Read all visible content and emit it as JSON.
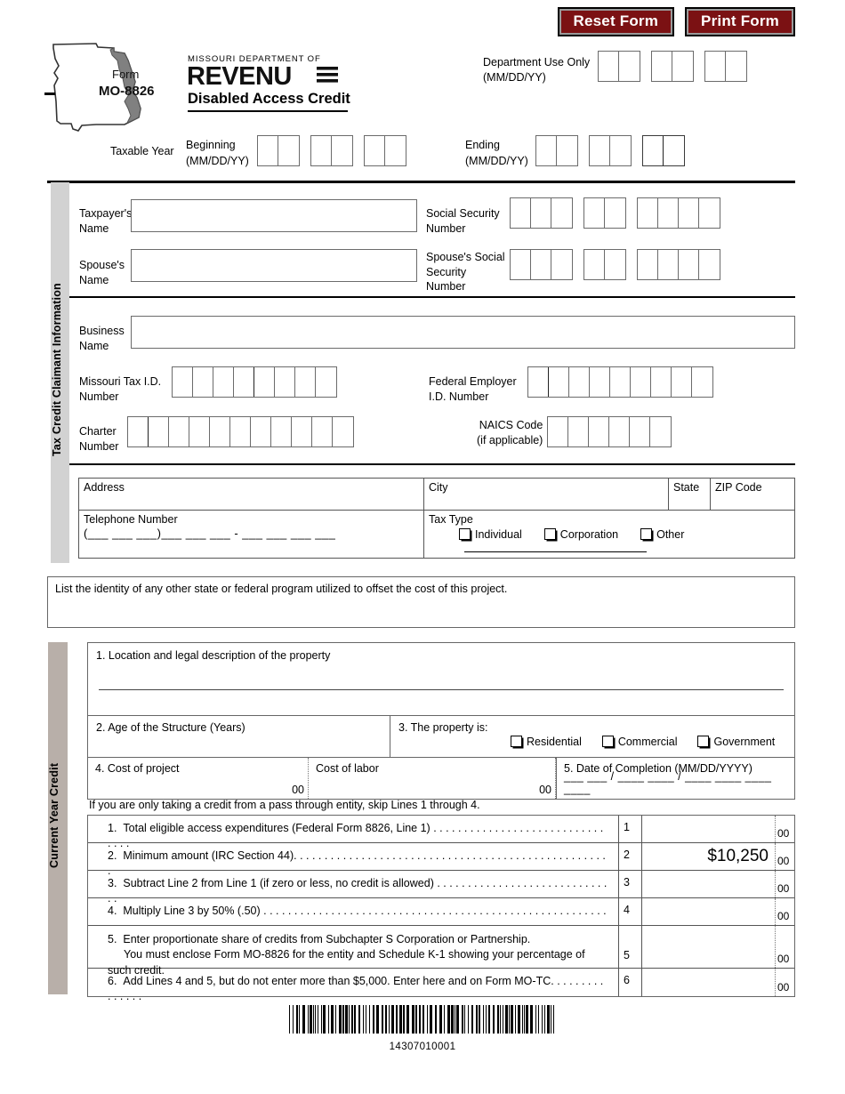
{
  "buttons": {
    "reset": "Reset Form",
    "print": "Print Form"
  },
  "logo": {
    "form_word": "Form",
    "form_number": "MO-8826",
    "dept_line": "MISSOURI DEPARTMENT OF",
    "brand": "REVENUE",
    "title": "Disabled Access Credit"
  },
  "dept_use": {
    "label": "Department Use Only",
    "format": "(MM/DD/YY)",
    "groups": 3,
    "cells_per_group": 2
  },
  "taxable_year": {
    "label": "Taxable Year",
    "beginning": "Beginning",
    "beginning_format": "(MM/DD/YY)",
    "ending": "Ending",
    "ending_format": "(MM/DD/YY)",
    "groups": 3,
    "cells_per_group": 2
  },
  "claimant": {
    "section_label": "Tax Credit Claimant Information",
    "taxpayer_name": "Taxpayer's\nName",
    "taxpayer_name_l1": "Taxpayer's",
    "taxpayer_name_l2": "Name",
    "spouse_name_l1": "Spouse's",
    "spouse_name_l2": "Name",
    "ssn_l1": "Social Security",
    "ssn_l2": "Number",
    "spouse_ssn_l1": "Spouse's Social",
    "spouse_ssn_l2": "Security",
    "spouse_ssn_l3": "Number",
    "business_name_l1": "Business",
    "business_name_l2": "Name",
    "mo_tax_id_l1": "Missouri Tax I.D.",
    "mo_tax_id_l2": "Number",
    "fein_l1": "Federal Employer",
    "fein_l2": "I.D. Number",
    "charter_l1": "Charter",
    "charter_l2": "Number",
    "naics_l1": "NAICS Code",
    "naics_l2": "(if applicable)",
    "ssn_groups": [
      3,
      2,
      4
    ],
    "mo_tax_id_cells": 8,
    "fein_cells": 9,
    "charter_cells": 11,
    "naics_cells": 6
  },
  "address": {
    "address": "Address",
    "city": "City",
    "state": "State",
    "zip": "ZIP Code",
    "telephone": "Telephone Number",
    "telephone_mask": "(___  ___  ___)___  ___  ___ - ___  ___  ___  ___",
    "tax_type": "Tax Type",
    "tax_type_options": [
      "Individual",
      "Corporation",
      "Other"
    ]
  },
  "offset": {
    "text": "List the identity of any other state or federal program utilized to offset the cost of this project."
  },
  "current_year_credit": {
    "section_label": "Current Year Credit",
    "q1": "1. Location and legal description of the property",
    "q2": "2. Age of the Structure (Years)",
    "q3": "3.  The property is:",
    "q3_options": [
      "Residential",
      "Commercial",
      "Government"
    ],
    "q4": "4.  Cost of project",
    "cost_of_labor": "Cost of labor",
    "cents": "00",
    "q5": "5.  Date of Completion (MM/DD/YYYY)",
    "date_mask": "___ ___ / ____ ____ / ____ ____ ____ ____",
    "note": "If you are only taking a credit from a pass through entity, skip Lines 1 through 4."
  },
  "lines": [
    {
      "no": "1.",
      "text": "Total eligible access expenditures (Federal Form 8826, Line 1)",
      "leader": ". . . . . . . . . . . . . . . . . . . . . . . . . . . . . . . .",
      "num": "1",
      "value": "",
      "cents": "00"
    },
    {
      "no": "2.",
      "text": "Minimum amount (IRC Section 44).",
      "leader": ". . . . . . . . . . . . . . . . . . . . . . . . . . . . . . . . . . . . . . . . . . . . . . . . . . .",
      "num": "2",
      "value": "$10,250",
      "cents": "00"
    },
    {
      "no": "3.",
      "text": "Subtract Line 2 from Line 1 (if zero or less, no credit is allowed)",
      "leader": " . . . . . . . . . . . . . . . . . . . . . . . . . . . . . .",
      "num": "3",
      "value": "",
      "cents": "00"
    },
    {
      "no": "4.",
      "text": "Multiply Line 3 by 50% (.50)",
      "leader": ". . . . . . . . . . . . . . . . . . . . . . . . . . . . . . . . . . . . . . . . . . . . . . . . . . . . . . . .",
      "num": "4",
      "value": "",
      "cents": "00"
    },
    {
      "no": "5.",
      "text": "Enter proportionate share of credits from Subchapter S Corporation or Partnership.",
      "text2": "You must enclose Form MO-8826 for the entity and Schedule K-1 showing your percentage of such credit.",
      "leader": "",
      "num": "5",
      "value": "",
      "cents": "00"
    },
    {
      "no": "6.",
      "text": "Add Lines 4 and 5, but do not enter more than $5,000.  Enter here and on Form MO-TC.",
      "leader": ". . . . . . . . . . . . . .",
      "num": "6",
      "value": "",
      "cents": "00"
    }
  ],
  "barcode": {
    "number": "14307010001"
  },
  "colors": {
    "button_red": "#7b1113",
    "sidebar_gray": "#d2d2d2",
    "sidebar_taupe": "#b8afa9"
  }
}
